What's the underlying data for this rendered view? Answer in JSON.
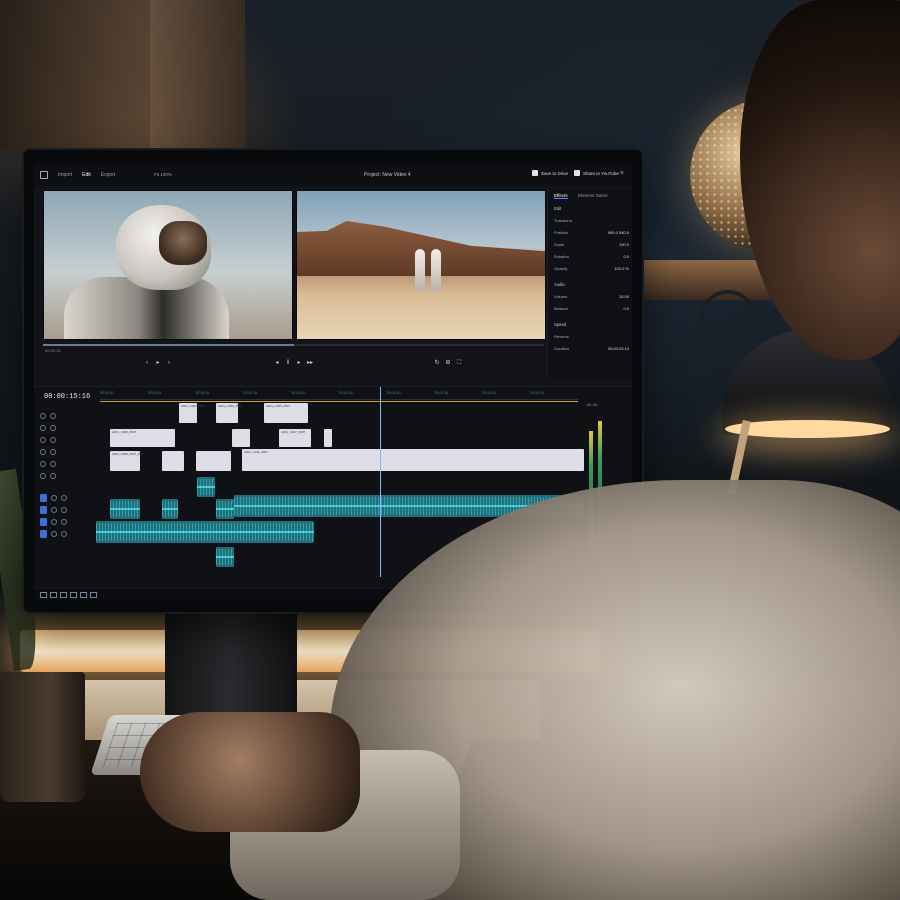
{
  "editor": {
    "nav": {
      "tabs": [
        "Import",
        "Edit",
        "Export"
      ],
      "active_tab": "Edit",
      "zoom_chip": "Fit  100%"
    },
    "project_title": "Project: New Video 4",
    "actions": {
      "save_label": "Save to Drive",
      "share_label": "Share to YouTube",
      "close": "×"
    },
    "viewer": {
      "left_meta": "00:00:16",
      "right_meta": "00:00:15:16",
      "progress": 0.5
    },
    "inspector": {
      "tabs": [
        "Effects",
        "Element Name"
      ],
      "active_tab": "Effects",
      "section_edit": "Edit",
      "rows": [
        {
          "label": "Transform",
          "value": ""
        },
        {
          "label": "Position",
          "value": "960.0   540.0"
        },
        {
          "label": "Scale",
          "value": "100.0"
        },
        {
          "label": "Rotation",
          "value": "0.0"
        },
        {
          "label": "Opacity",
          "value": "100.0 %"
        }
      ],
      "audio_section": "Audio",
      "audio_rows": [
        {
          "label": "Volume",
          "value": "15.00"
        },
        {
          "label": "Balance",
          "value": "0.0"
        }
      ],
      "speed_section": "Speed",
      "speed_rows": [
        {
          "label": "Reverse",
          "value": ""
        },
        {
          "label": "Duration",
          "value": "00:00:29:10"
        }
      ]
    },
    "timeline": {
      "timecode": "00:00:15:16",
      "ruler_ticks": [
        "00:00:00",
        "00:00:05",
        "00:00:10",
        "00:00:15",
        "00:00:20",
        "00:00:25",
        "00:00:30",
        "00:00:35",
        "00:00:40",
        "00:00:45"
      ],
      "meter_label": "-00  -00",
      "clips": [
        {
          "label": "A001_C003_0507"
        },
        {
          "label": "A001_C004_0507"
        },
        {
          "label": "A001_C005_0507"
        },
        {
          "label": "A001_C006_0507"
        },
        {
          "label": "A001_C007_0507"
        },
        {
          "label": "A001_C008_0507_001"
        },
        {
          "label": "A001_C011_0507"
        }
      ]
    }
  },
  "colors": {
    "accent": "#3b6fd6",
    "audio": "#1d6f7a",
    "audio_wave": "#3cc8d6",
    "clip": "#dcdde6",
    "lamp_glow": "#ffd9a0"
  }
}
